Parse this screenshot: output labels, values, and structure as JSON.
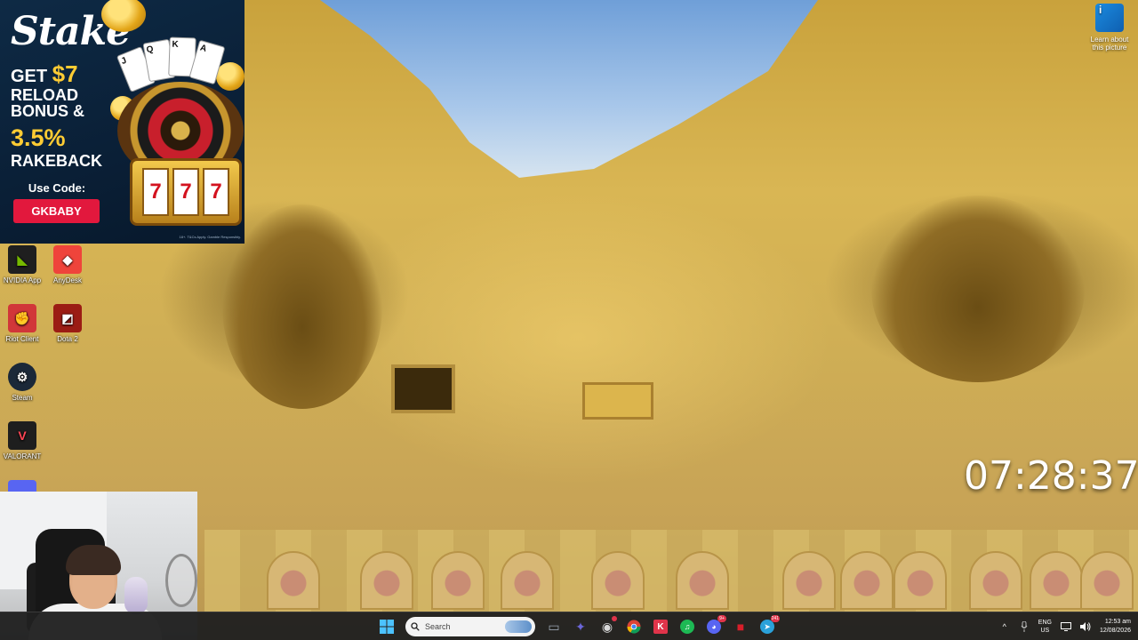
{
  "ad": {
    "brand": "Stake",
    "line_get": "GET ",
    "amount": "$7",
    "line_reload": "RELOAD BONUS &",
    "percent": "3.5%",
    "line_rake": "RAKEBACK",
    "code_label": "Use Code:",
    "code": "GKBABY",
    "fine_print": "18+. T&Cs Apply. Gamble Responsibly.",
    "slot_symbols": [
      "7",
      "7",
      "7"
    ],
    "card_labels": [
      "J",
      "Q",
      "K",
      "A"
    ]
  },
  "desktop_icons": [
    {
      "label": "NVIDIA App",
      "icon": "nvidia-icon",
      "color": "#1f1f1f",
      "glyph": "◣"
    },
    {
      "label": "AnyDesk",
      "icon": "anydesk-icon",
      "color": "#ef443b",
      "glyph": "◆"
    },
    {
      "label": "Riot Client",
      "icon": "riot-client-icon",
      "color": "#d13639",
      "glyph": "✊"
    },
    {
      "label": "Dota 2",
      "icon": "dota2-icon",
      "color": "#9b1c14",
      "glyph": "◩"
    },
    {
      "label": "Steam",
      "icon": "steam-icon",
      "color": "#1b2838",
      "glyph": "⚙"
    },
    {
      "label": "VALORANT",
      "icon": "valorant-icon",
      "color": "#1e1e1e",
      "glyph": "V"
    }
  ],
  "learn": {
    "label_line1": "Learn about",
    "label_line2": "this picture"
  },
  "clock": {
    "time": "07:28:37"
  },
  "taskbar": {
    "search_placeholder": "Search",
    "apps": [
      {
        "name": "file-explorer-window-icon",
        "glyph": "▭",
        "color": "#9aa3b0"
      },
      {
        "name": "teams-icon",
        "glyph": "✦",
        "color": "#6b66d9"
      },
      {
        "name": "obs-icon",
        "glyph": "◉",
        "color": "#d9d9d9",
        "badge": ""
      },
      {
        "name": "chrome-icon",
        "glyph": "●",
        "color": "#e8b624"
      },
      {
        "name": "app-k-icon",
        "glyph": "K",
        "color": "#e0344a"
      },
      {
        "name": "spotify-icon",
        "glyph": "♫",
        "color": "#1db954"
      },
      {
        "name": "discord-icon",
        "glyph": "◕",
        "color": "#5865f2",
        "badge": "9+"
      },
      {
        "name": "red-app-icon",
        "glyph": "■",
        "color": "#d81e2a"
      },
      {
        "name": "telegram-icon",
        "glyph": "➤",
        "color": "#2aa1da",
        "badge": "241"
      }
    ],
    "tray": {
      "lang_line1": "ENG",
      "lang_line2": "US",
      "time": "12:53 am",
      "date": "12/08/2026"
    }
  }
}
